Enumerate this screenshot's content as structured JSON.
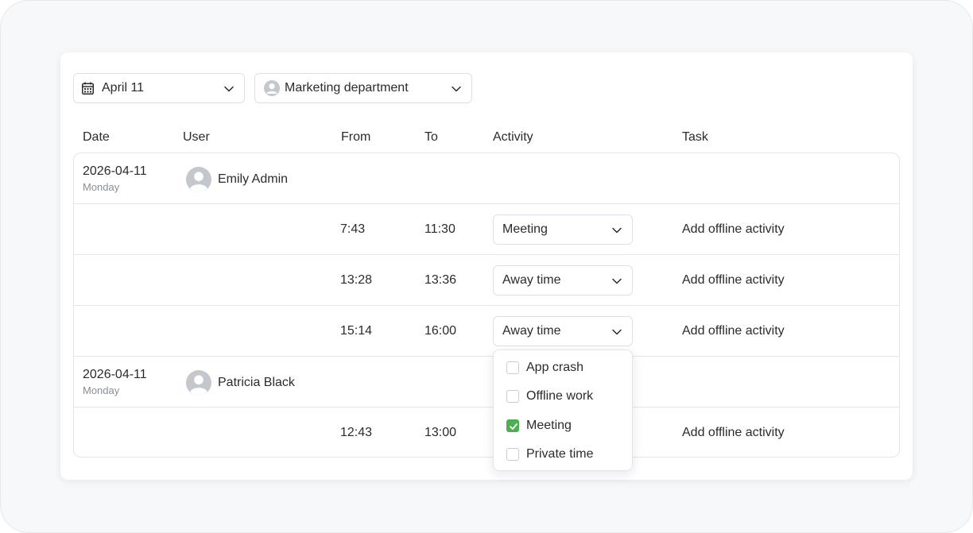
{
  "filters": {
    "date": {
      "label": "April 11",
      "icon": "calendar-icon"
    },
    "department": {
      "label": "Marketing department",
      "icon": "user-avatar-icon"
    }
  },
  "columns": {
    "date": "Date",
    "user": "User",
    "from": "From",
    "to": "To",
    "activity": "Activity",
    "task": "Task"
  },
  "groups": [
    {
      "date": "2026-04-11",
      "weekday": "Monday",
      "user": "Emily Admin",
      "entries": [
        {
          "from": "7:43",
          "to": "11:30",
          "activity": "Meeting",
          "task": "Add offline activity"
        },
        {
          "from": "13:28",
          "to": "13:36",
          "activity": "Away time",
          "task": "Add offline activity"
        },
        {
          "from": "15:14",
          "to": "16:00",
          "activity": "Away time",
          "task": "Add offline activity"
        }
      ]
    },
    {
      "date": "2026-04-11",
      "weekday": "Monday",
      "user": "Patricia Black",
      "entries": [
        {
          "from": "12:43",
          "to": "13:00",
          "activity": "",
          "task": "Add offline activity"
        }
      ]
    }
  ],
  "activity_menu": {
    "open_on_row": 3,
    "options": [
      {
        "label": "App crash",
        "checked": false
      },
      {
        "label": "Offline work",
        "checked": false
      },
      {
        "label": "Meeting",
        "checked": true
      },
      {
        "label": "Private time",
        "checked": false
      }
    ]
  },
  "colors": {
    "check": "#4caf50",
    "border": "#e3e5e9",
    "muted_text": "#8a8f98",
    "background": "#f7f8fa"
  }
}
